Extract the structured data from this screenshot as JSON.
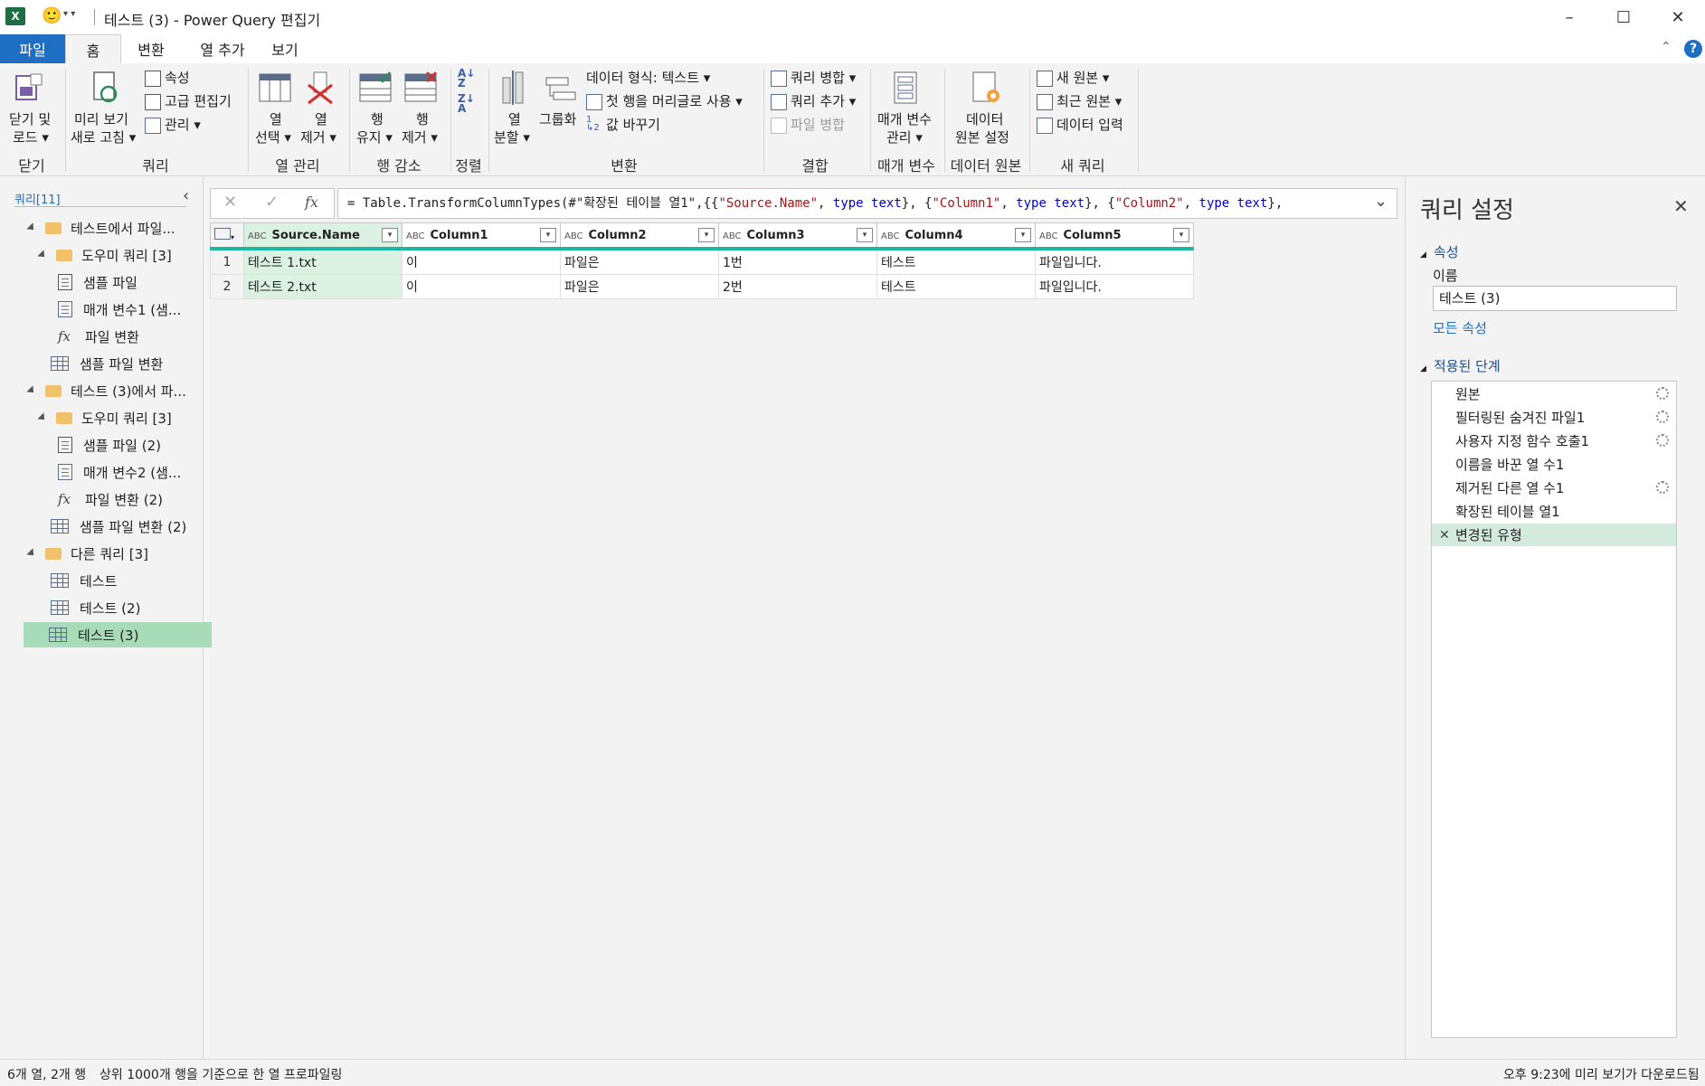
{
  "window": {
    "title": "테스트 (3) - Power Query 편집기",
    "smiley": "🙂"
  },
  "tabs": [
    "파일",
    "홈",
    "변환",
    "열 추가",
    "보기"
  ],
  "ribbon": {
    "close": {
      "label1": "닫기 및",
      "label2": "로드 ▾",
      "group": "닫기"
    },
    "query": {
      "refresh1": "미리 보기",
      "refresh2": "새로 고침 ▾",
      "properties": "속성",
      "advanced_editor": "고급 편집기",
      "manage": "관리 ▾",
      "group": "쿼리"
    },
    "manage_columns": {
      "choose1": "열",
      "choose2": "선택 ▾",
      "remove1": "열",
      "remove2": "제거 ▾",
      "group": "열 관리"
    },
    "reduce_rows": {
      "keep1": "행",
      "keep2": "유지 ▾",
      "remove1": "행",
      "remove2": "제거 ▾",
      "group": "행 감소"
    },
    "sort": {
      "group": "정렬"
    },
    "transform": {
      "split1": "열",
      "split2": "분할 ▾",
      "group_by": "그룹화",
      "data_type": "데이터 형식: 텍스트 ▾",
      "use_first_row": "첫 행을 머리글로 사용 ▾",
      "replace_values": "값 바꾸기",
      "group": "변환"
    },
    "combine": {
      "merge": "쿼리 병합 ▾",
      "append": "쿼리 추가 ▾",
      "combine_files": "파일 병합",
      "group": "결합"
    },
    "parameters": {
      "label1": "매개 변수",
      "label2": "관리 ▾",
      "group": "매개 변수"
    },
    "data_source": {
      "label1": "데이터",
      "label2": "원본 설정",
      "group": "데이터 원본"
    },
    "new_query": {
      "new_source": "새 원본 ▾",
      "recent": "최근 원본 ▾",
      "enter_data": "데이터 입력",
      "group": "새 쿼리"
    }
  },
  "query_pane": {
    "header": "쿼리[11]",
    "items": [
      {
        "label": "테스트에서 파일...",
        "type": "folder",
        "level": 0
      },
      {
        "label": "도우미 쿼리 [3]",
        "type": "folder",
        "level": 1
      },
      {
        "label": "샘플 파일",
        "type": "doc",
        "level": 2
      },
      {
        "label": "매개 변수1 (샘...",
        "type": "param",
        "level": 2
      },
      {
        "label": "파일 변환",
        "type": "fx",
        "level": 2
      },
      {
        "label": "샘플 파일 변환",
        "type": "table",
        "level": 1
      },
      {
        "label": "테스트 (3)에서 파...",
        "type": "folder",
        "level": 0
      },
      {
        "label": "도우미 쿼리 [3]",
        "type": "folder",
        "level": 1
      },
      {
        "label": "샘플 파일 (2)",
        "type": "doc",
        "level": 2
      },
      {
        "label": "매개 변수2 (샘...",
        "type": "param",
        "level": 2
      },
      {
        "label": "파일 변환 (2)",
        "type": "fx",
        "level": 2
      },
      {
        "label": "샘플 파일 변환 (2)",
        "type": "table",
        "level": 1
      },
      {
        "label": "다른 쿼리 [3]",
        "type": "folder",
        "level": 0
      },
      {
        "label": "테스트",
        "type": "table",
        "level": 1
      },
      {
        "label": "테스트 (2)",
        "type": "table",
        "level": 1
      },
      {
        "label": "테스트 (3)",
        "type": "table",
        "level": 1,
        "selected": true
      }
    ]
  },
  "formula": {
    "prefix": "= Table.TransformColumnTypes(#\"확장된 테이블 열1\",{{",
    "parts": [
      {
        "t": "\"Source.Name\"",
        "c": "str"
      },
      {
        "t": ", ",
        "c": "p"
      },
      {
        "t": "type",
        "c": "kw"
      },
      {
        "t": " ",
        "c": "p"
      },
      {
        "t": "text",
        "c": "kw"
      },
      {
        "t": "}, {",
        "c": "p"
      },
      {
        "t": "\"Column1\"",
        "c": "str"
      },
      {
        "t": ", ",
        "c": "p"
      },
      {
        "t": "type",
        "c": "kw"
      },
      {
        "t": " ",
        "c": "p"
      },
      {
        "t": "text",
        "c": "kw"
      },
      {
        "t": "}, {",
        "c": "p"
      },
      {
        "t": "\"Column2\"",
        "c": "str"
      },
      {
        "t": ", ",
        "c": "p"
      },
      {
        "t": "type",
        "c": "kw"
      },
      {
        "t": " ",
        "c": "p"
      },
      {
        "t": "text",
        "c": "kw"
      },
      {
        "t": "},",
        "c": "p"
      }
    ]
  },
  "table": {
    "columns": [
      "Source.Name",
      "Column1",
      "Column2",
      "Column3",
      "Column4",
      "Column5"
    ],
    "type_icon": "ABC",
    "rows": [
      [
        "1",
        "테스트 1.txt",
        "이",
        "파일은",
        "1번",
        "테스트",
        "파일입니다."
      ],
      [
        "2",
        "테스트 2.txt",
        "이",
        "파일은",
        "2번",
        "테스트",
        "파일입니다."
      ]
    ]
  },
  "settings": {
    "title": "쿼리 설정",
    "properties_header": "속성",
    "name_label": "이름",
    "name_value": "테스트 (3)",
    "all_properties": "모든 속성",
    "steps_header": "적용된 단계",
    "steps": [
      {
        "label": "원본",
        "gear": true
      },
      {
        "label": "필터링된 숨겨진 파일1",
        "gear": true
      },
      {
        "label": "사용자 지정 함수 호출1",
        "gear": true
      },
      {
        "label": "이름을 바꾼 열 수1",
        "gear": false
      },
      {
        "label": "제거된 다른 열 수1",
        "gear": true
      },
      {
        "label": "확장된 테이블 열1",
        "gear": false
      },
      {
        "label": "변경된 유형",
        "gear": false,
        "selected": true
      }
    ]
  },
  "status": {
    "left1": "6개 열, 2개 행",
    "left2": "상위 1000개 행을 기준으로 한 열 프로파일링",
    "right": "오후 9:23에 미리 보기가 다운로드됨"
  },
  "colors": {
    "accent": "#1e6fc4",
    "selection": "#a8dbb8",
    "header_bar": "#1fb5a3",
    "string": "#a31515",
    "keyword": "#0000cc"
  }
}
